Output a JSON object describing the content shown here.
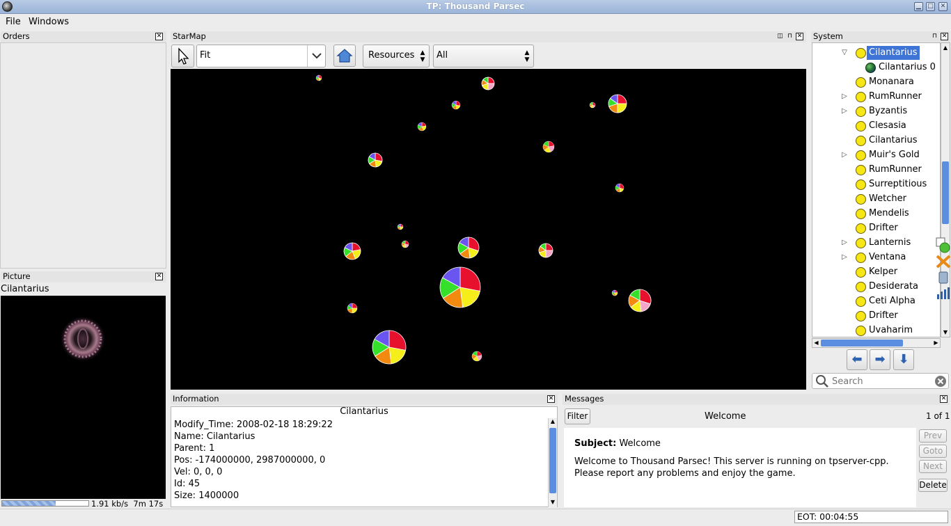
{
  "window": {
    "title": "TP: Thousand Parsec"
  },
  "menu": {
    "file": "File",
    "windows": "Windows"
  },
  "orders": {
    "title": "Orders"
  },
  "picture": {
    "title": "Picture",
    "object_name": "Cilantarius"
  },
  "starmap": {
    "title": "StarMap",
    "zoom_value": "Fit",
    "overlay_value": "Resources",
    "filter_value": "All"
  },
  "system": {
    "title": "System",
    "items": [
      {
        "label": "Cilantarius",
        "selected": true,
        "expanded": true,
        "level": 1,
        "icon": "star-icon"
      },
      {
        "label": "Cilantarius 0",
        "level": 2,
        "icon": "planet-icon"
      },
      {
        "label": "Monanara",
        "level": 1,
        "icon": "star-icon"
      },
      {
        "label": "RumRunner",
        "level": 1,
        "icon": "star-icon",
        "expandable": true
      },
      {
        "label": "Byzantis",
        "level": 1,
        "icon": "star-icon",
        "expandable": true
      },
      {
        "label": "Clesasia",
        "level": 1,
        "icon": "star-icon"
      },
      {
        "label": "Cilantarius",
        "level": 1,
        "icon": "star-icon"
      },
      {
        "label": "Muir's Gold",
        "level": 1,
        "icon": "star-icon",
        "expandable": true
      },
      {
        "label": "RumRunner",
        "level": 1,
        "icon": "star-icon"
      },
      {
        "label": "Surreptitious",
        "level": 1,
        "icon": "star-icon"
      },
      {
        "label": "Wetcher",
        "level": 1,
        "icon": "star-icon"
      },
      {
        "label": "Mendelis",
        "level": 1,
        "icon": "star-icon"
      },
      {
        "label": "Drifter",
        "level": 1,
        "icon": "star-icon"
      },
      {
        "label": "Lanternis",
        "level": 1,
        "icon": "star-icon",
        "expandable": true
      },
      {
        "label": "Ventana",
        "level": 1,
        "icon": "star-icon",
        "expandable": true
      },
      {
        "label": "Kelper",
        "level": 1,
        "icon": "star-icon"
      },
      {
        "label": "Desiderata",
        "level": 1,
        "icon": "star-icon"
      },
      {
        "label": "Ceti Alpha",
        "level": 1,
        "icon": "star-icon"
      },
      {
        "label": "Drifter",
        "level": 1,
        "icon": "star-icon"
      },
      {
        "label": "Uvaharim",
        "level": 1,
        "icon": "star-icon"
      }
    ],
    "search_placeholder": "Search"
  },
  "information": {
    "title": "Information",
    "heading": "Cilantarius",
    "lines": [
      "Modify_Time: 2008-02-18 18:29:22",
      "Name: Cilantarius",
      "Parent: 1",
      "Pos: -174000000, 2987000000, 0",
      "Vel: 0, 0, 0",
      "Id: 45",
      "Size: 1400000"
    ]
  },
  "messages": {
    "title": "Messages",
    "filter_label": "Filter",
    "current_title": "Welcome",
    "counter": "1 of 1",
    "subject_label": "Subject:",
    "subject_value": "Welcome",
    "body_line1": "Welcome to Thousand Parsec! This server is running on tpserver-cpp.",
    "body_line2": "Please report any problems and enjoy the game.",
    "buttons": {
      "prev": "Prev",
      "goto": "Goto",
      "next": "Next",
      "delete": "Delete"
    }
  },
  "status": {
    "net_speed": "1.91 kb/s",
    "time_left": "7m 17s",
    "progress": 0.62,
    "eot": "EOT: 00:04:55"
  },
  "colors": {
    "selection": "#3d74d5",
    "pie_red": "#e8112d",
    "pie_yellow": "#f5ee1a",
    "pie_orange": "#f28a10",
    "pie_green": "#35e02b",
    "pie_blue": "#6b55f0",
    "pie_pink": "#f4a6c8"
  }
}
